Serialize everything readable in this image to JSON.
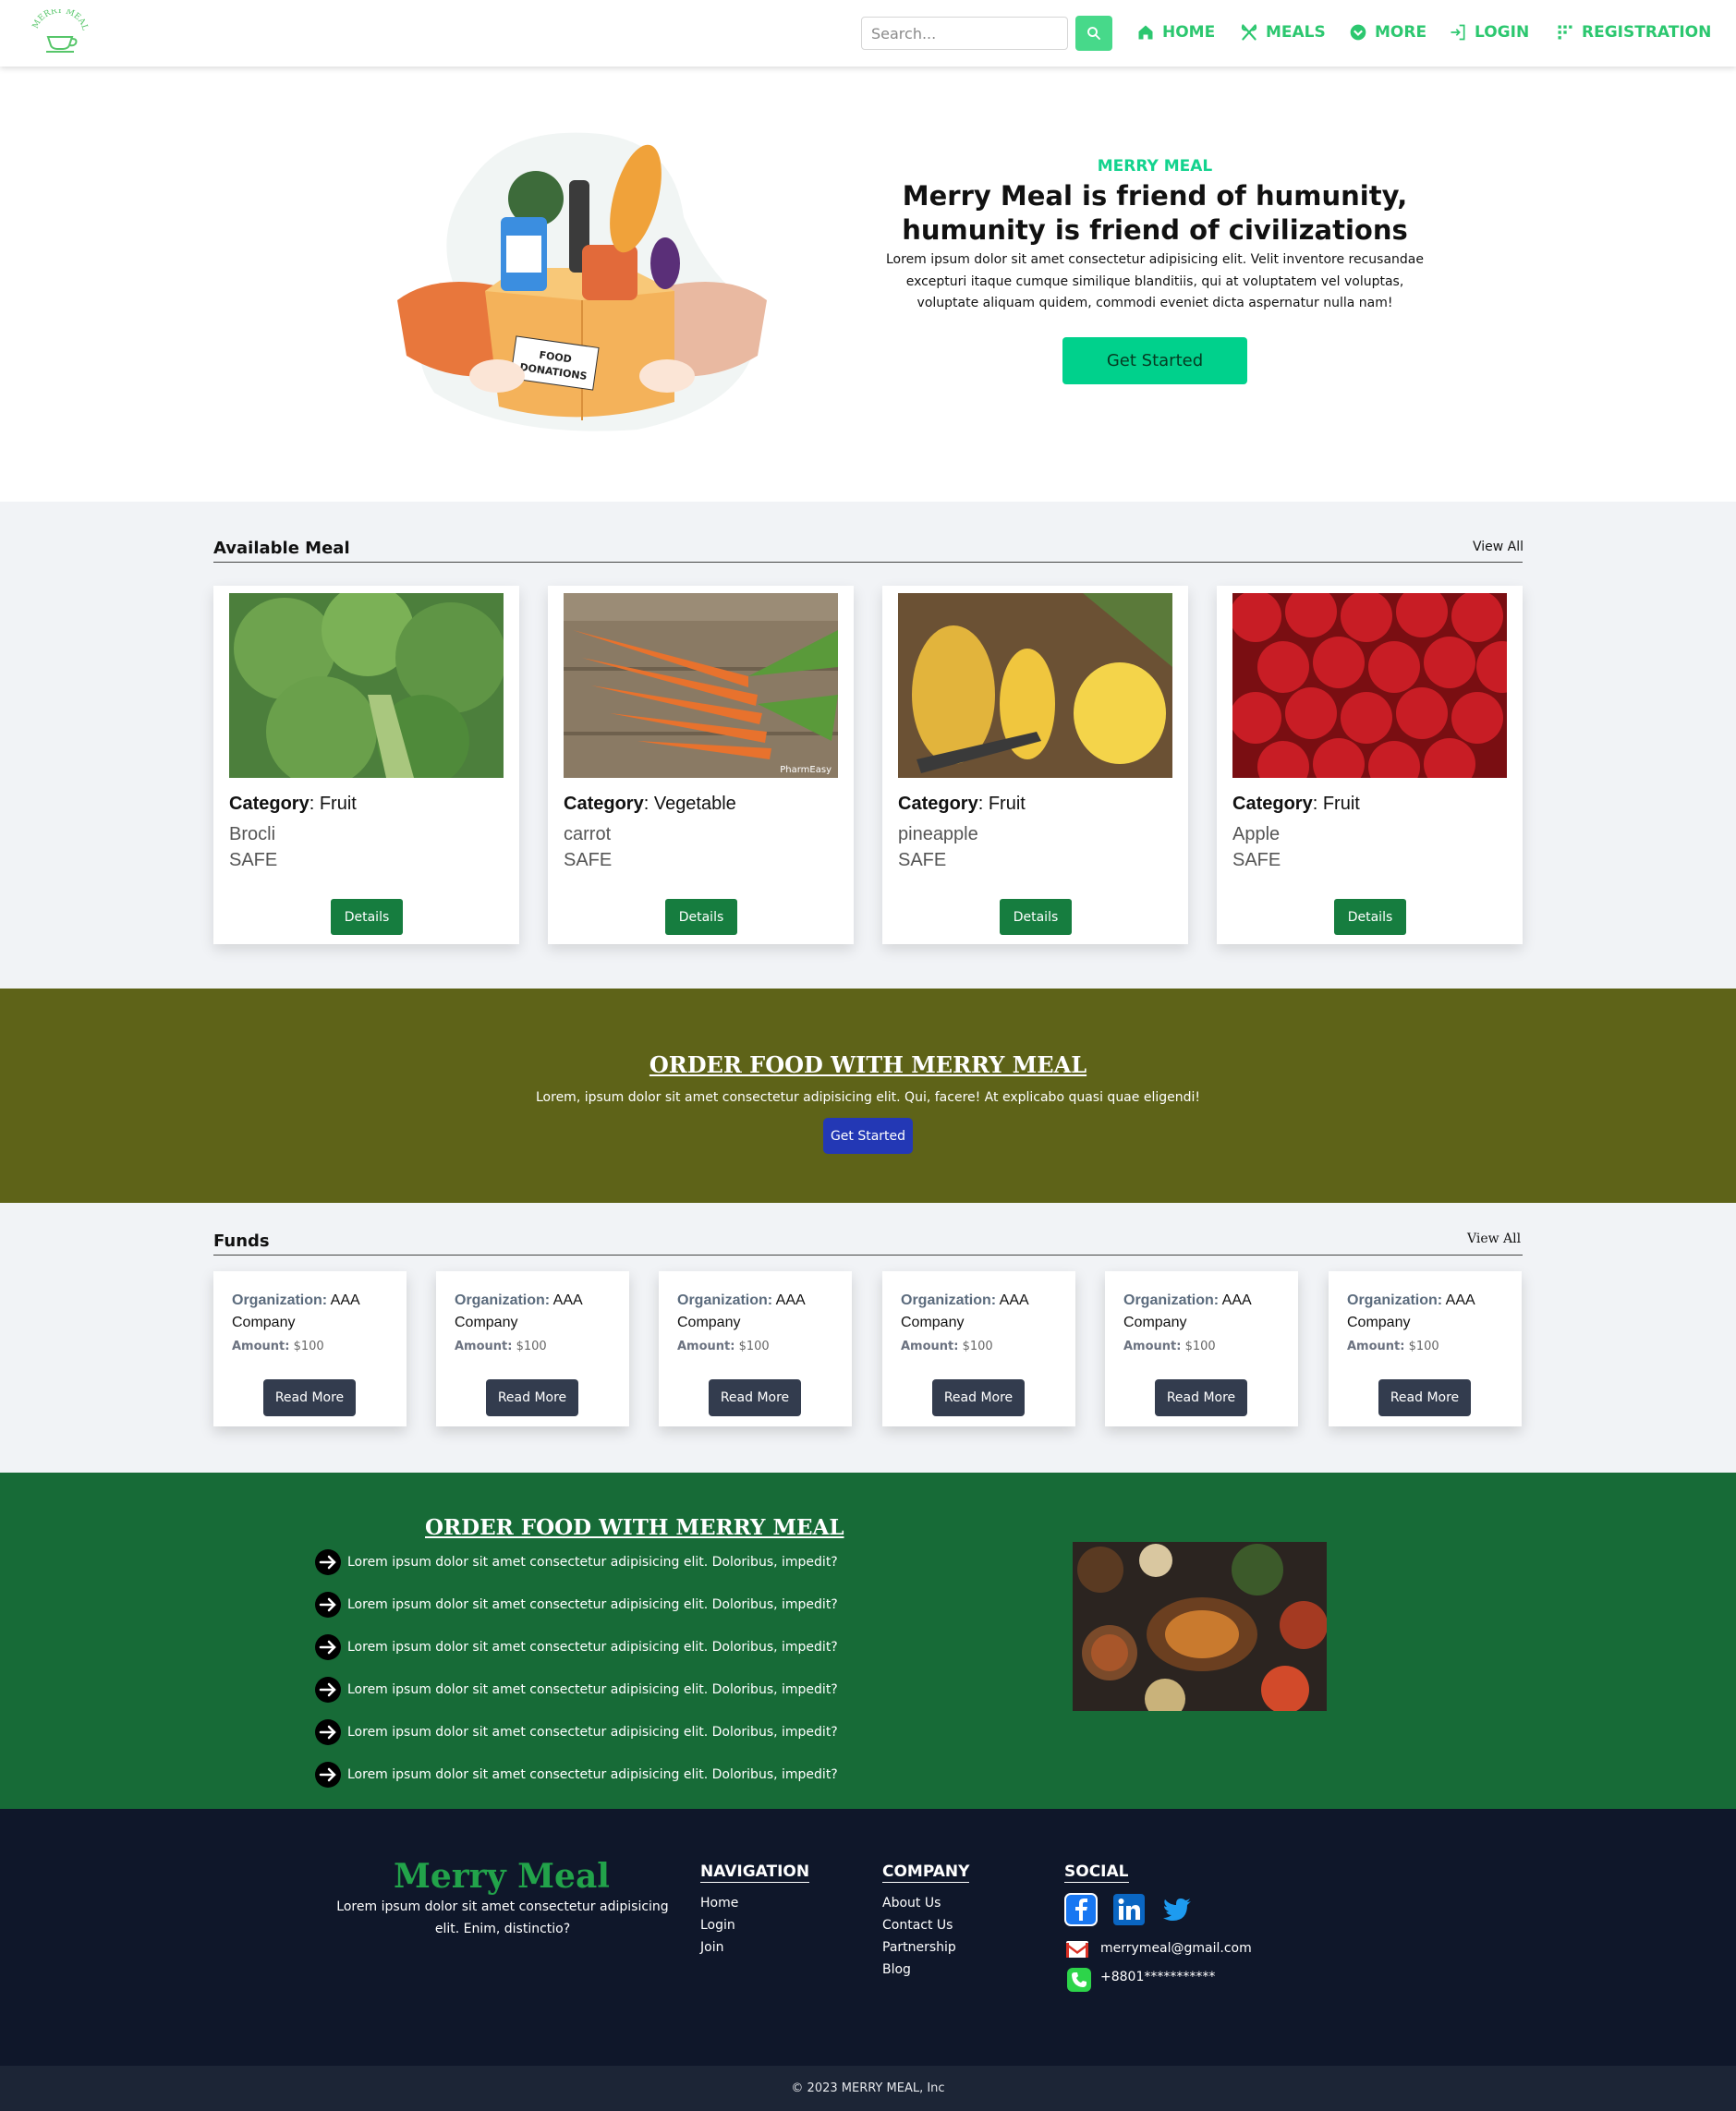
{
  "nav": {
    "logo_text": "MERRY MEAL",
    "search_placeholder": "Search...",
    "links": [
      {
        "label": "HOME",
        "icon": "home-icon"
      },
      {
        "label": "MEALS",
        "icon": "utensils-icon"
      },
      {
        "label": "MORE",
        "icon": "chevron-circle-icon"
      },
      {
        "label": "LOGIN",
        "icon": "login-icon"
      },
      {
        "label": "REGISTRATION",
        "icon": "grid-icon"
      }
    ],
    "accent_color": "#2cc76f"
  },
  "hero": {
    "kicker": "MERRY MEAL",
    "title": "Merry Meal is friend of humunity, humunity is friend of civilizations",
    "text": "Lorem ipsum dolor sit amet consectetur adipisicing elit. Velit inventore recusandae excepturi itaque cumque similique blanditiis, qui at voluptatem vel voluptas, voluptate aliquam quidem, commodi eveniet dicta aspernatur nulla nam!",
    "button": "Get Started",
    "illustration_label": "FOOD DONATIONS",
    "button_color": "#00d18c"
  },
  "meals": {
    "title": "Available Meal",
    "view_all": "View All",
    "category_label": "Category",
    "details_label": "Details",
    "items": [
      {
        "category": "Fruit",
        "name": "Brocli",
        "status": "SAFE",
        "image": "broccoli"
      },
      {
        "category": "Vegetable",
        "name": "carrot",
        "status": "SAFE",
        "image": "carrots"
      },
      {
        "category": "Fruit",
        "name": "pineapple",
        "status": "SAFE",
        "image": "pineapple"
      },
      {
        "category": "Fruit",
        "name": "Apple",
        "status": "SAFE",
        "image": "apples"
      }
    ],
    "image_watermark": "PharmEasy"
  },
  "order": {
    "title": "ORDER FOOD WITH MERRY MEAL",
    "text": "Lorem, ipsum dolor sit amet consectetur adipisicing elit. Qui, facere! At explicabo quasi quae eligendi!",
    "button": "Get Started",
    "band_color": "#5e6318"
  },
  "funds": {
    "title": "Funds",
    "view_all": "View All",
    "org_label": "Organization:",
    "amount_label": "Amount:",
    "button": "Read More",
    "items": [
      {
        "org": "AAA Company",
        "amount": "$100"
      },
      {
        "org": "AAA Company",
        "amount": "$100"
      },
      {
        "org": "AAA Company",
        "amount": "$100"
      },
      {
        "org": "AAA Company",
        "amount": "$100"
      },
      {
        "org": "AAA Company",
        "amount": "$100"
      },
      {
        "org": "AAA Company",
        "amount": "$100"
      }
    ]
  },
  "features": {
    "title": "ORDER FOOD WITH MERRY MEAL",
    "items": [
      "Lorem ipsum dolor sit amet consectetur adipisicing elit. Doloribus, impedit?",
      "Lorem ipsum dolor sit amet consectetur adipisicing elit. Doloribus, impedit?",
      "Lorem ipsum dolor sit amet consectetur adipisicing elit. Doloribus, impedit?",
      "Lorem ipsum dolor sit amet consectetur adipisicing elit. Doloribus, impedit?",
      "Lorem ipsum dolor sit amet consectetur adipisicing elit. Doloribus, impedit?",
      "Lorem ipsum dolor sit amet consectetur adipisicing elit. Doloribus, impedit?"
    ],
    "bullet_icon": "arrow-right-circle-icon",
    "section_color": "#176b37"
  },
  "footer": {
    "brand": "Merry Meal",
    "brand_text": "Lorem ipsum dolor sit amet consectetur adipisicing elit. Enim, distinctio?",
    "navigation": {
      "title": "NAVIGATION",
      "links": [
        "Home",
        "Login",
        "Join"
      ]
    },
    "company": {
      "title": "COMPANY",
      "links": [
        "About Us",
        "Contact Us",
        "Partnership",
        "Blog"
      ]
    },
    "social": {
      "title": "SOCIAL",
      "icons": [
        "facebook-icon",
        "linkedin-icon",
        "twitter-icon"
      ]
    },
    "email": "merrymeal@gmail.com",
    "phone": "+8801***********",
    "copyright": "© 2023 MERRY MEAL, Inc"
  }
}
